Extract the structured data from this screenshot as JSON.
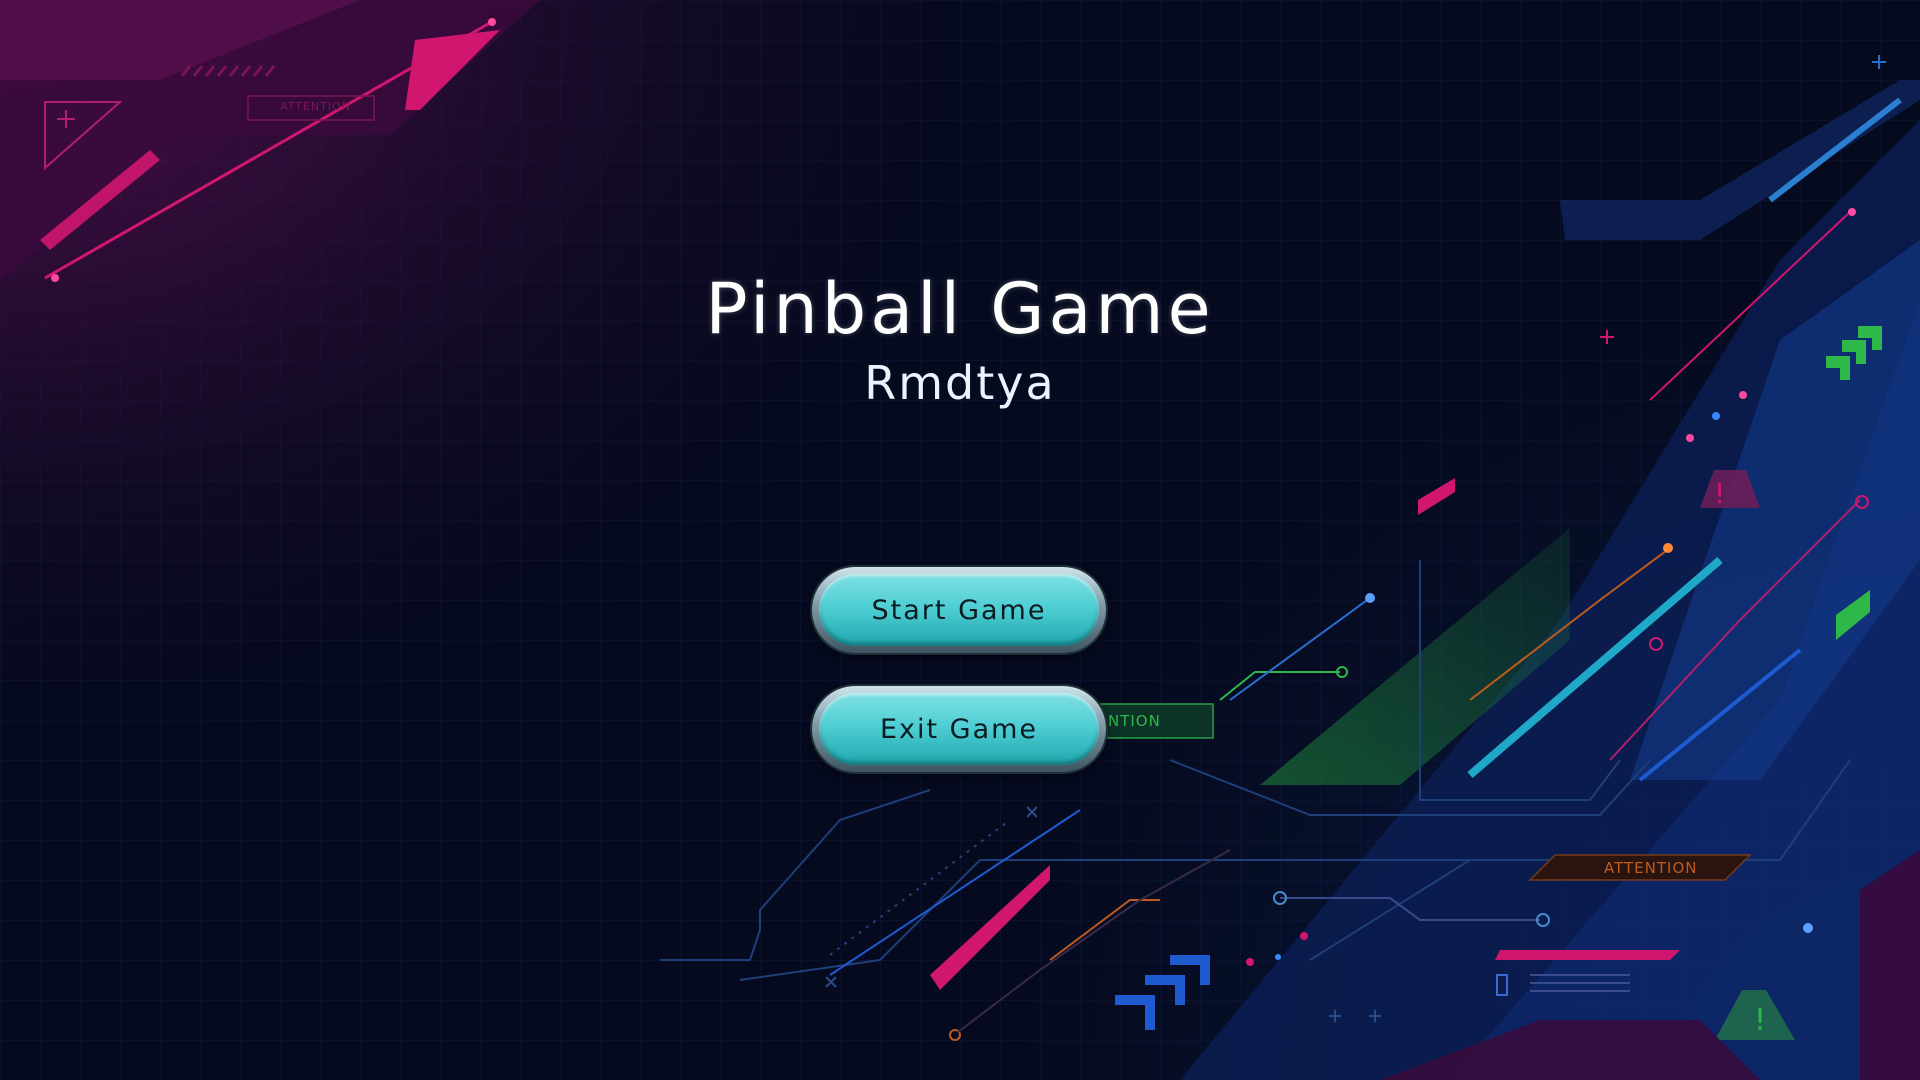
{
  "game": {
    "title": "Pinball Game",
    "subtitle": "Rmdtya"
  },
  "menu": {
    "start_label": "Start Game",
    "exit_label": "Exit Game"
  },
  "decor": {
    "attention_label": "ATTENTION",
    "attention_partial": "NTION"
  },
  "colors": {
    "background": "#050a1e",
    "accent_magenta": "#d0166f",
    "accent_cyan": "#1fa8c8",
    "accent_green": "#2fb84a",
    "button_teal": "#4fcfd4"
  }
}
